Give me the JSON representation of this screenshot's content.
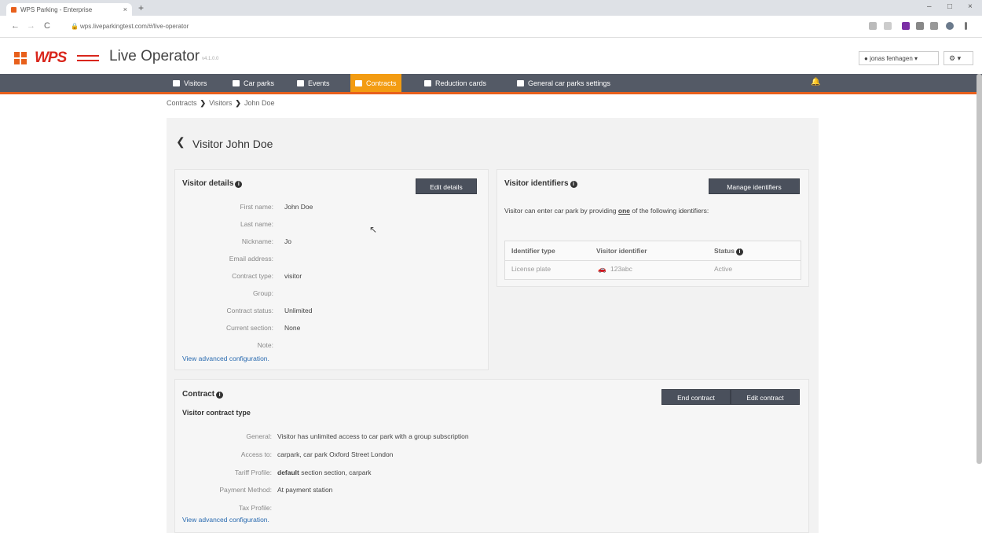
{
  "browser": {
    "tab_title": "WPS Parking - Enterprise",
    "tab_close": "×",
    "new_tab": "+",
    "nav_back": "←",
    "nav_forward": "→",
    "nav_reload": "C",
    "lock": "🔒",
    "url": "wps.liveparkingtest.com/#/live-operator",
    "win_minimize": "–",
    "win_maximize": "□",
    "win_close": "×"
  },
  "app": {
    "logo_text": "WPS",
    "title": "Live Operator",
    "version": "v4.1.0.0",
    "user_label": "jonas fenhagen",
    "user_caret": "▾",
    "gear": "⚙",
    "gear_caret": "▾"
  },
  "nav": {
    "items": [
      {
        "label": "Visitors"
      },
      {
        "label": "Car parks"
      },
      {
        "label": "Events"
      },
      {
        "label": "Contracts"
      },
      {
        "label": "Reduction cards"
      },
      {
        "label": "General car parks settings"
      }
    ],
    "bell": "🔔"
  },
  "breadcrumb": {
    "items": [
      "Contracts",
      "Visitors",
      "John Doe"
    ],
    "separator": "❯"
  },
  "page": {
    "back_icon": "❮",
    "title": "Visitor John Doe"
  },
  "visitor_details": {
    "title": "Visitor details",
    "info": "i",
    "edit_button": "Edit details",
    "fields": [
      {
        "label": "First name:",
        "value": "John Doe"
      },
      {
        "label": "Last name:",
        "value": ""
      },
      {
        "label": "Nickname:",
        "value": "Jo"
      },
      {
        "label": "Email address:",
        "value": ""
      },
      {
        "label": "Contract type:",
        "value": "visitor"
      },
      {
        "label": "Group:",
        "value": ""
      },
      {
        "label": "Contract status:",
        "value": "Unlimited"
      },
      {
        "label": "Current section:",
        "value": "None"
      },
      {
        "label": "Note:",
        "value": ""
      }
    ],
    "advanced_link": "View advanced configuration."
  },
  "identifiers": {
    "title": "Visitor identifiers",
    "info": "i",
    "manage_button": "Manage identifiers",
    "intro_before": "Visitor can enter car park by providing ",
    "intro_bold": "one",
    "intro_after": " of the following identifiers:",
    "columns": [
      "Identifier type",
      "Visitor identifier",
      "Status"
    ],
    "status_info": "i",
    "rows": [
      {
        "type": "License plate",
        "icon": "🚗",
        "identifier": "123abc",
        "status": "Active"
      }
    ]
  },
  "contract": {
    "title": "Contract",
    "info": "i",
    "end_button": "End contract",
    "edit_button": "Edit contract",
    "subtitle": "Visitor contract type",
    "fields": [
      {
        "label": "General:",
        "value": "Visitor has unlimited access to car park with a group subscription"
      },
      {
        "label": "Access to:",
        "value": "carpark, car park Oxford Street London"
      },
      {
        "label": "Tariff Profile:",
        "value_bold": "default",
        "value": " section section, carpark"
      },
      {
        "label": "Payment Method:",
        "value": "At payment station"
      },
      {
        "label": "Tax Profile:",
        "value": ""
      }
    ],
    "advanced_link": "View advanced configuration."
  },
  "colors": {
    "accent": "#e8601c",
    "nav_bg": "#545a66",
    "nav_active": "#f39c12",
    "button_bg": "#4a505c",
    "link": "#2a6bb0"
  }
}
